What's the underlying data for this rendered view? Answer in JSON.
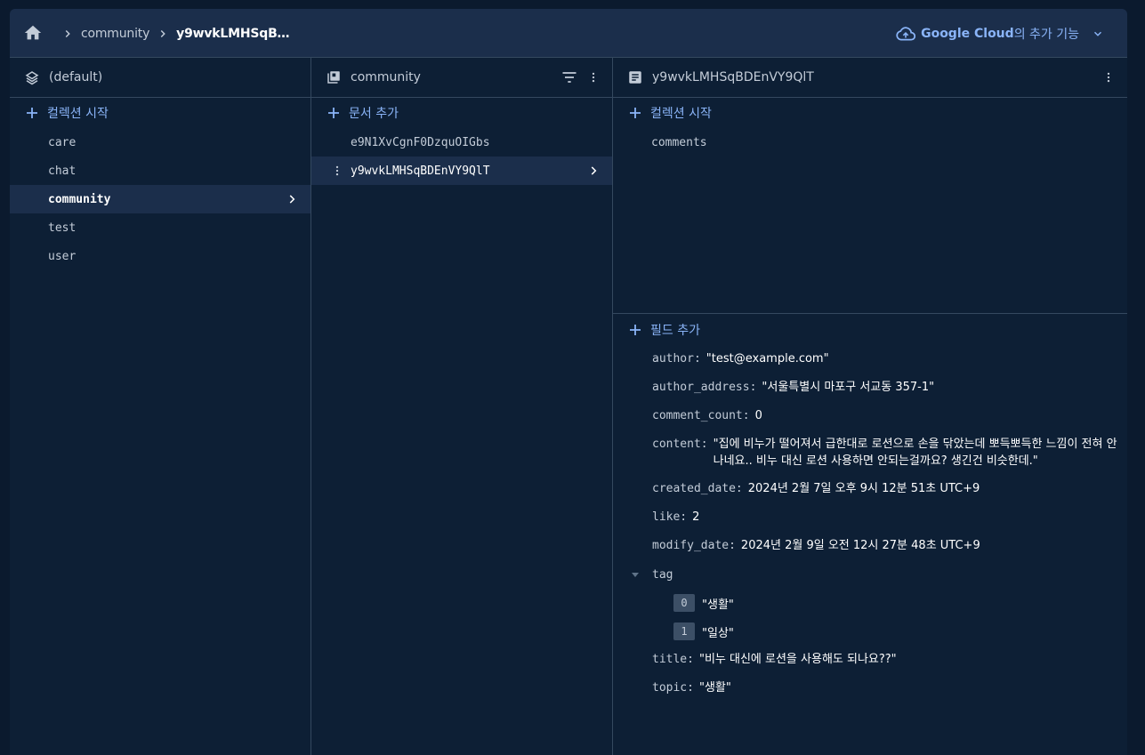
{
  "breadcrumb": {
    "items": [
      "community",
      "y9wvkLMHSqB…"
    ]
  },
  "addon": {
    "brand": "Google Cloud",
    "suffix": "의 추가 기능"
  },
  "col1": {
    "title": "(default)",
    "add_label": "컬렉션 시작",
    "items": [
      "care",
      "chat",
      "community",
      "test",
      "user"
    ]
  },
  "col2": {
    "title": "community",
    "add_label": "문서 추가",
    "items": [
      "e9N1XvCgnF0DzquOIGbs",
      "y9wvkLMHSqBDEnVY9QlT"
    ]
  },
  "col3": {
    "title": "y9wvkLMHSqBDEnVY9QlT",
    "add_collection_label": "컬렉션 시작",
    "subcollections": [
      "comments"
    ],
    "add_field_label": "필드 추가",
    "fields": {
      "author": {
        "key": "author:",
        "value": "\"test@example.com\""
      },
      "author_address": {
        "key": "author_address:",
        "value": "\"서울특별시 마포구 서교동 357-1\""
      },
      "comment_count": {
        "key": "comment_count:",
        "value": "0"
      },
      "content": {
        "key": "content:",
        "value": "\"집에 비누가 떨어져서 급한대로 로션으로 손을 닦았는데 뽀득뽀득한 느낌이 전혀 안 나네요.. 비누 대신 로션 사용하면 안되는걸까요? 생긴건 비슷한데.\""
      },
      "created_date": {
        "key": "created_date:",
        "value": "2024년 2월 7일 오후 9시 12분 51초 UTC+9"
      },
      "like": {
        "key": "like:",
        "value": "2"
      },
      "modify_date": {
        "key": "modify_date:",
        "value": "2024년 2월 9일 오전 12시 27분 48초 UTC+9"
      },
      "tag": {
        "key": "tag",
        "items": [
          {
            "index": "0",
            "value": "\"생활\""
          },
          {
            "index": "1",
            "value": "\"일상\""
          }
        ]
      },
      "title": {
        "key": "title:",
        "value": "\"비누 대신에 로션을 사용해도 되나요??\""
      },
      "topic": {
        "key": "topic:",
        "value": "\"생활\""
      }
    }
  },
  "colors": {
    "accent": "#8ab4f8",
    "background": "#0d1f35",
    "header": "#1b2e4b",
    "selected": "#1b2e4b"
  }
}
